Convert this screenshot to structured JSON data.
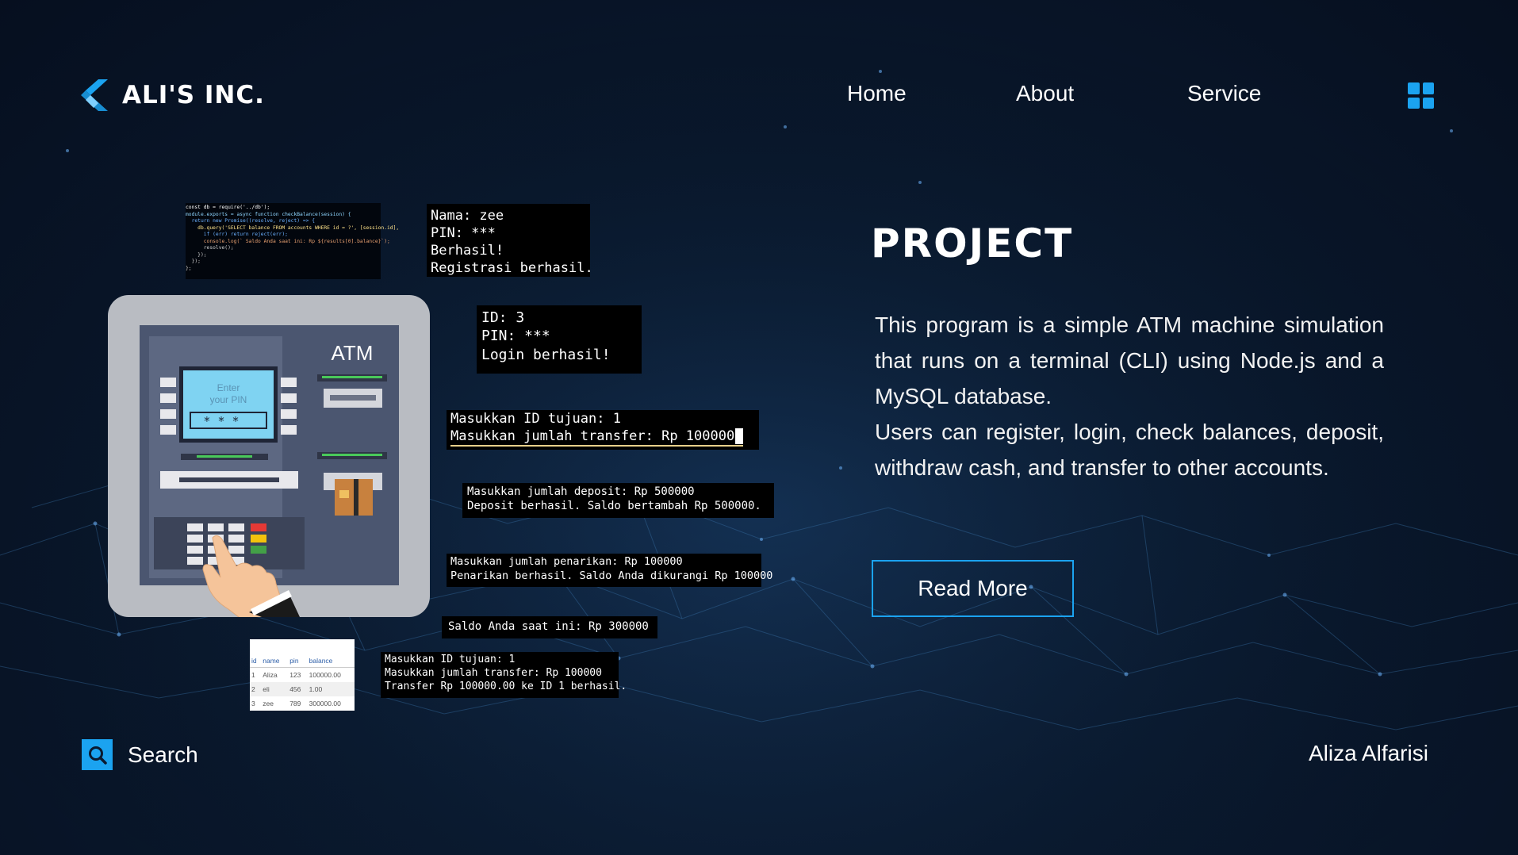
{
  "brand": {
    "name": "ALI'S INC.",
    "logo_icon": "flutter-like-chevron-icon",
    "accent": "#1ba3f0"
  },
  "nav": {
    "items": [
      {
        "label": "Home"
      },
      {
        "label": "About"
      },
      {
        "label": "Service"
      }
    ],
    "menu_icon": "grid-icon"
  },
  "hero": {
    "title": "PROJECT",
    "description": [
      "This program is a simple ATM machine simulation that runs on a terminal (CLI) using Node.js and a MySQL database.",
      "Users can register, login, check balances, deposit, withdraw cash, and transfer to other accounts."
    ],
    "button": "Read More"
  },
  "atm_illustration": {
    "label": "ATM",
    "screen_line1": "Enter",
    "screen_line2": "your PIN",
    "pin_mask": "* * * _"
  },
  "code_snippet": [
    "const db = require('../db');",
    "",
    "module.exports = async function checkBalance(session) {",
    "  return new Promise((resolve, reject) => {",
    "    db.query('SELECT balance FROM accounts WHERE id = ?', [session.id],",
    "      if (err) return reject(err);",
    "      console.log(` Saldo Anda saat ini: Rp ${results[0].balance}`);",
    "      resolve();",
    "    });",
    "  });",
    "};"
  ],
  "terminals": {
    "register": [
      "Nama: zee",
      "PIN: ***",
      "Berhasil!",
      "Registrasi berhasil."
    ],
    "login": [
      "ID: 3",
      "PIN: ***",
      "Login berhasil!"
    ],
    "transfer_input": [
      "Masukkan ID tujuan: 1",
      "Masukkan jumlah transfer: Rp 100000"
    ],
    "deposit": [
      "Masukkan jumlah deposit: Rp 500000",
      "Deposit berhasil. Saldo bertambah Rp 500000."
    ],
    "withdraw": [
      "Masukkan jumlah penarikan: Rp 100000",
      "Penarikan berhasil. Saldo Anda dikurangi Rp 100000"
    ],
    "balance": [
      "Saldo Anda saat ini: Rp 300000"
    ],
    "transfer_result": [
      "Masukkan ID tujuan: 1",
      "Masukkan jumlah transfer: Rp 100000",
      "Transfer Rp 100000.00 ke ID 1 berhasil."
    ]
  },
  "db_table": {
    "headers": [
      "id",
      "name",
      "pin",
      "balance"
    ],
    "rows": [
      [
        "1",
        "Aliza",
        "123",
        "100000.00"
      ],
      [
        "2",
        "eli",
        "456",
        "1.00"
      ],
      [
        "3",
        "zee",
        "789",
        "300000.00"
      ]
    ]
  },
  "footer": {
    "search_label": "Search",
    "search_icon": "search-icon",
    "author": "Aliza Alfarisi"
  }
}
